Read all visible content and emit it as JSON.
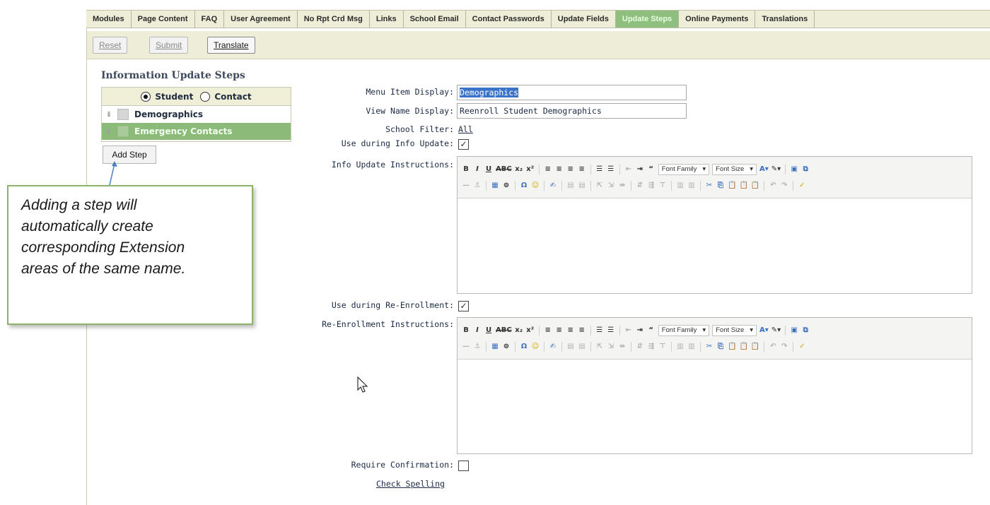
{
  "tabs": [
    {
      "label": "Modules",
      "active": false
    },
    {
      "label": "Page Content",
      "active": false
    },
    {
      "label": "FAQ",
      "active": false
    },
    {
      "label": "User Agreement",
      "active": false
    },
    {
      "label": "No Rpt Crd Msg",
      "active": false
    },
    {
      "label": "Links",
      "active": false
    },
    {
      "label": "School Email",
      "active": false
    },
    {
      "label": "Contact Passwords",
      "active": false
    },
    {
      "label": "Update Fields",
      "active": false
    },
    {
      "label": "Update Steps",
      "active": true
    },
    {
      "label": "Online Payments",
      "active": false
    },
    {
      "label": "Translations",
      "active": false
    }
  ],
  "actions": {
    "reset": "Reset",
    "submit": "Submit",
    "translate": "Translate"
  },
  "left": {
    "title": "Information Update Steps",
    "radio_student": "Student",
    "radio_contact": "Contact",
    "selected_radio": "Student",
    "steps": [
      {
        "label": "Demographics",
        "selected": false
      },
      {
        "label": "Emergency Contacts",
        "selected": true
      }
    ],
    "add_step": "Add Step"
  },
  "callout": {
    "lines": [
      "Adding a step will",
      "automatically create",
      "corresponding Extension",
      "areas of the same name."
    ]
  },
  "form": {
    "menu_item_label": "Menu Item Display:",
    "menu_item_value": "Demographics",
    "view_name_label": "View Name Display:",
    "view_name_value": "Reenroll Student Demographics",
    "school_filter_label": "School Filter:",
    "school_filter_value": "All",
    "use_info_label": "Use during Info Update:",
    "use_info_checked": true,
    "info_instr_label": "Info Update Instructions:",
    "use_reenroll_label": "Use during Re-Enrollment:",
    "use_reenroll_checked": true,
    "reenroll_instr_label": "Re-Enrollment Instructions:",
    "require_conf_label": "Require Confirmation:",
    "require_conf_checked": false,
    "check_spelling": "Check Spelling"
  },
  "editor": {
    "font_family": "Font Family",
    "font_size": "Font Size"
  },
  "colors": {
    "tab_active": "#8fbf7f",
    "selected_row": "#8cba79",
    "callout_border": "#8bb36a",
    "highlight": "#3b73c9"
  }
}
